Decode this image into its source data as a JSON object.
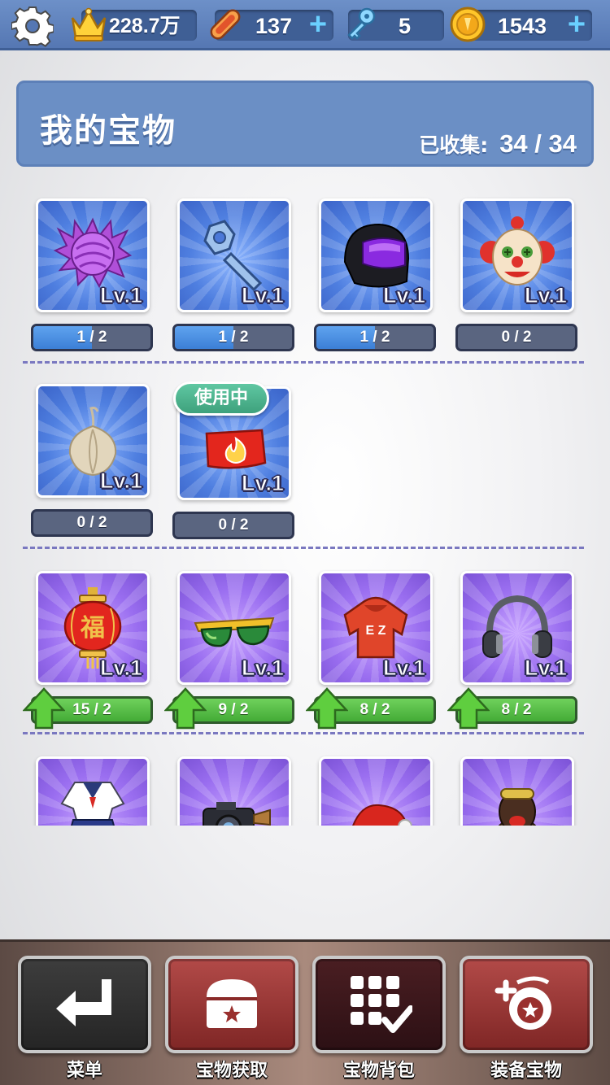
{
  "topbar": {
    "crown_value": "228.7万",
    "skateboard_value": "137",
    "key_value": "5",
    "coin_value": "1543",
    "plus": "+"
  },
  "header": {
    "title": "我的宝物",
    "collected_label": "已收集:",
    "collected_value": "34 / 34"
  },
  "rows": [
    [
      {
        "icon": "purple-cabbage-icon",
        "level": "Lv.1",
        "progress": "1 / 2",
        "fill": 0.5,
        "bg": "blue"
      },
      {
        "icon": "wrench-icon",
        "level": "Lv.1",
        "progress": "1 / 2",
        "fill": 0.5,
        "bg": "blue"
      },
      {
        "icon": "helmet-icon",
        "level": "Lv.1",
        "progress": "1 / 2",
        "fill": 0.5,
        "bg": "blue"
      },
      {
        "icon": "clown-mask-icon",
        "level": "Lv.1",
        "progress": "0 / 2",
        "fill": 0,
        "bg": "blue"
      }
    ],
    [
      {
        "icon": "garlic-bulb-icon",
        "level": "Lv.1",
        "progress": "0 / 2",
        "fill": 0,
        "bg": "blue"
      },
      {
        "icon": "flame-cap-icon",
        "level": "Lv.1",
        "progress": "0 / 2",
        "fill": 0,
        "bg": "blue",
        "badge": "使用中"
      }
    ],
    [
      {
        "icon": "red-lantern-icon",
        "level": "Lv.1",
        "progress": "15 / 2",
        "fill": 1,
        "bg": "purple",
        "upgrade": true
      },
      {
        "icon": "sunglasses-icon",
        "level": "Lv.1",
        "progress": "9 / 2",
        "fill": 1,
        "bg": "purple",
        "upgrade": true
      },
      {
        "icon": "red-hoodie-icon",
        "level": "Lv.1",
        "progress": "8 / 2",
        "fill": 1,
        "bg": "purple",
        "upgrade": true
      },
      {
        "icon": "headphones-icon",
        "level": "Lv.1",
        "progress": "8 / 2",
        "fill": 1,
        "bg": "purple",
        "upgrade": true
      }
    ],
    [
      {
        "icon": "sailor-uniform-icon",
        "bg": "purple"
      },
      {
        "icon": "camera-icon",
        "bg": "purple"
      },
      {
        "icon": "santa-hat-icon",
        "bg": "purple"
      },
      {
        "icon": "character-head-icon",
        "bg": "purple"
      }
    ]
  ],
  "bottom_nav": [
    {
      "label": "菜单",
      "icon": "return-arrow-icon",
      "style": "dark"
    },
    {
      "label": "宝物获取",
      "icon": "treasure-chest-icon",
      "style": "red"
    },
    {
      "label": "宝物背包",
      "icon": "grid-check-icon",
      "style": "maroon"
    },
    {
      "label": "装备宝物",
      "icon": "equip-treasure-icon",
      "style": "red"
    }
  ],
  "colors": {
    "topbar": "#5a7ab6",
    "header_panel": "#6b8fc5",
    "progress_blue": "#4a8ce0",
    "progress_green": "#56bf47",
    "inuse_badge": "#4fb48e"
  }
}
